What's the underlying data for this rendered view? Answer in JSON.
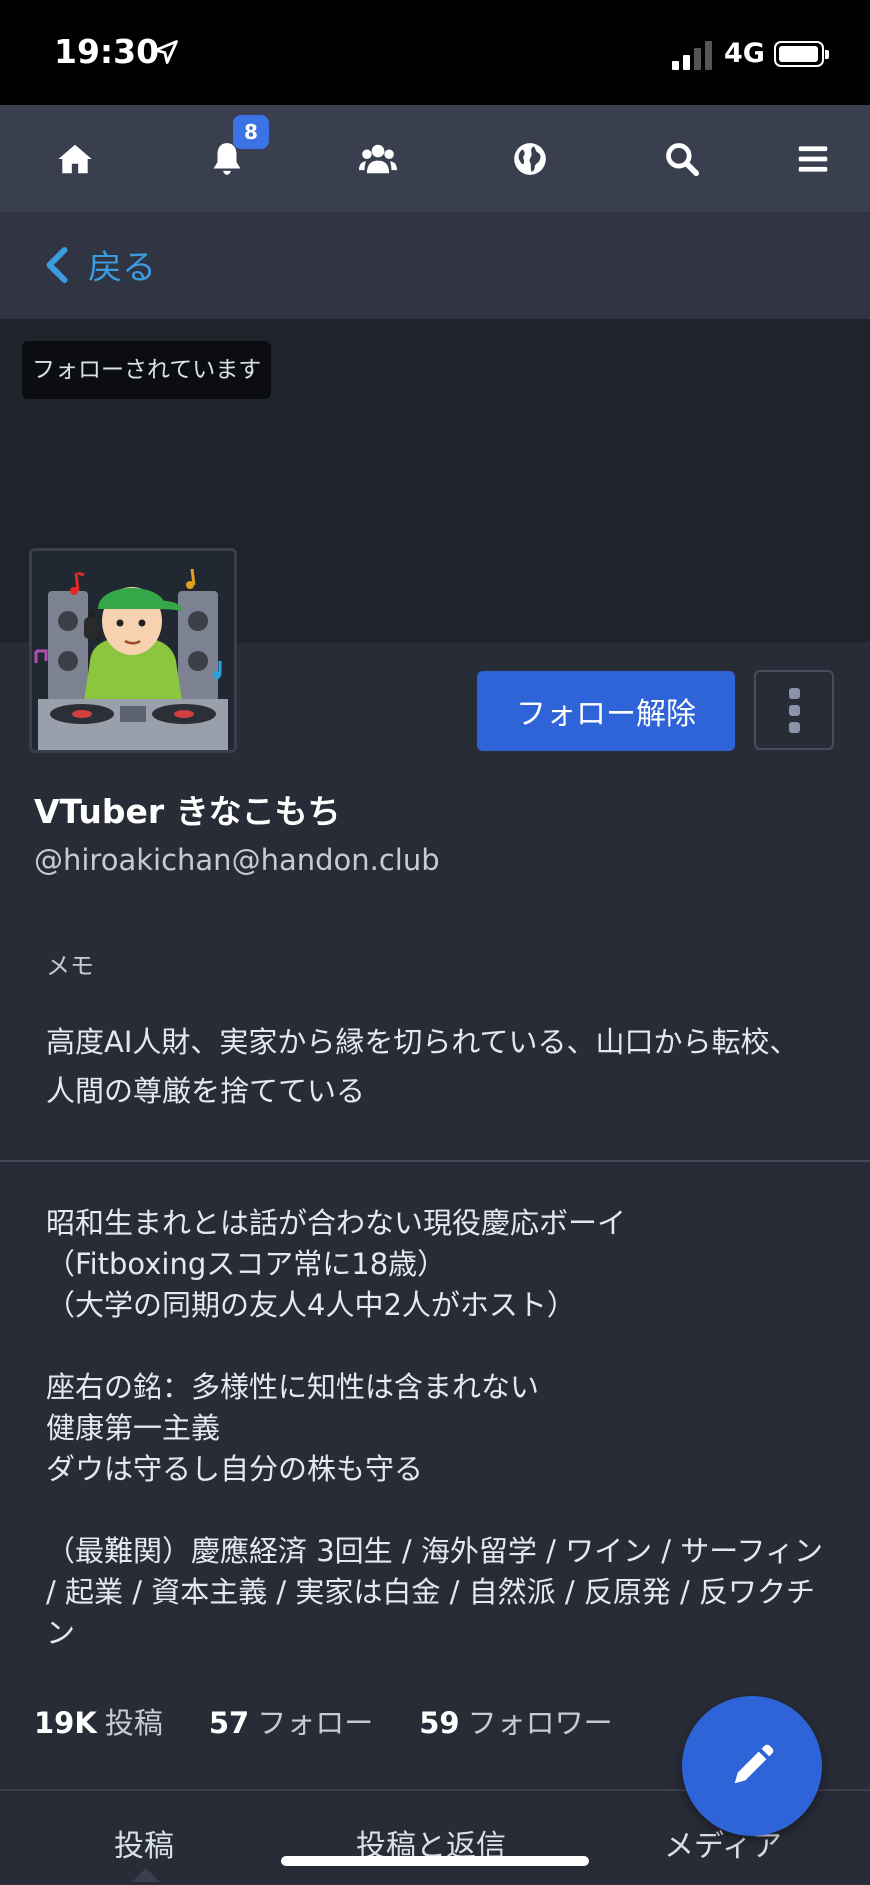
{
  "status_bar": {
    "time": "19:30",
    "carrier": "4G"
  },
  "nav": {
    "items": [
      "home-icon",
      "bell-icon",
      "users-icon",
      "globe-icon",
      "search-icon",
      "menu-icon"
    ],
    "notification_count": "8"
  },
  "back": {
    "label": "戻る"
  },
  "profile": {
    "followed_badge": "フォローされています",
    "unfollow_label": "フォロー解除",
    "display_name": "VTuber きなこもち",
    "account": "@hiroakichan@handon.club",
    "memo_label": "メモ",
    "memo_text": "高度AI人財、実家から縁を切られている、山口から転校、人間の尊厳を捨てている",
    "bio": {
      "line1": "昭和生まれとは話が合わない現役慶応ボーイ",
      "line2": "（Fitboxingスコア常に18歳）",
      "line3": "（大学の同期の友人4人中2人がホスト）",
      "line4": "座右の銘：多様性に知性は含まれない",
      "line5": "健康第一主義",
      "line6": "ダウは守るし自分の株も守る",
      "line7": "（最難関）慶應経済 3回生 / 海外留学 / ワイン / サーフィン / 起業 / 資本主義 / 実家は白金 / 自然派 / 反原発 / 反ワクチン"
    },
    "stats": {
      "posts_count": "19K",
      "posts_label": "投稿",
      "following_count": "57",
      "following_label": "フォロー",
      "followers_count": "59",
      "followers_label": "フォロワー"
    }
  },
  "tabs": [
    "投稿",
    "投稿と返信",
    "メディア"
  ],
  "colors": {
    "accent": "#2f64d9",
    "link": "#3b9ce0",
    "background": "#282c37"
  }
}
